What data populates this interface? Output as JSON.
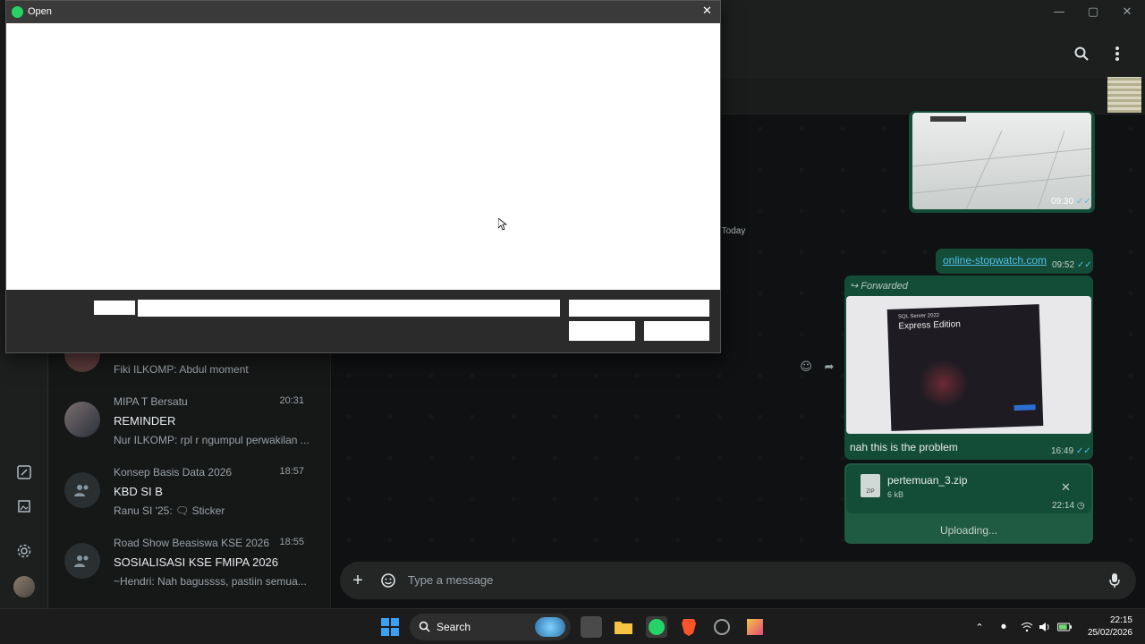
{
  "dialog": {
    "title": "Open"
  },
  "window_controls": {
    "minimize": "—",
    "maximize": "▢",
    "close": "✕"
  },
  "chats": [
    {
      "subtitle": "",
      "title": "",
      "last": "Fiki ILKOMP: Abdul moment",
      "time": ""
    },
    {
      "subtitle": "MIPA T Bersatu",
      "title": "REMINDER",
      "last": "Nur ILKOMP: rpl r ngumpul perwakilan ...",
      "time": "20:31"
    },
    {
      "subtitle": "Konsep Basis Data 2026",
      "title": "KBD SI B",
      "last": "Ranu SI '25: 🗨 Sticker",
      "time": "18:57"
    },
    {
      "subtitle": "Road Show Beasiswa KSE 2026",
      "title": "SOSIALISASI KSE FMIPA 2026",
      "last": "~Hendri: Nah bagussss, pastiin semua...",
      "time": "18:55"
    }
  ],
  "conversation": {
    "day_label": "Today",
    "messages": {
      "image1_time": "09:30",
      "link_text": "online-stopwatch.com",
      "link_time": "09:52",
      "forwarded_label": "Forwarded",
      "image2_overlay_title": "SQL Server 2022",
      "image2_overlay_sub": "Express Edition",
      "image2_caption": "nah this is the problem",
      "image2_time": "16:49",
      "file_name": "pertemuan_3.zip",
      "file_size": "6 kB",
      "file_time": "22:14",
      "file_badge": "ZIP",
      "upload_status": "Uploading..."
    },
    "composer_placeholder": "Type a message"
  },
  "taskbar": {
    "search_label": "Search",
    "time": "22:15",
    "date": "25/02/2026"
  },
  "colors": {
    "accent": "#25d366",
    "bubble_out": "#144d37",
    "link": "#53bdeb"
  }
}
